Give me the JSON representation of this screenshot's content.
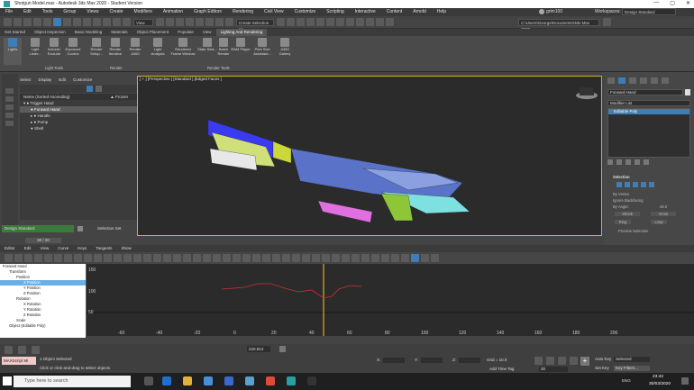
{
  "window": {
    "title": "Shotgun Model.max - Autodesk 3ds Max 2020 - Student Version",
    "controls": [
      "—",
      "▢",
      "✕"
    ]
  },
  "menu": [
    "File",
    "Edit",
    "Tools",
    "Group",
    "Views",
    "Create",
    "Modifiers",
    "Animation",
    "Graph Editors",
    "Rendering",
    "Civil View",
    "Customize",
    "Scripting",
    "Interactive",
    "Content",
    "Arnold",
    "Help"
  ],
  "menu_right": {
    "user": "grim100",
    "workspaces_label": "Workspaces:",
    "workspace": "Design Standard"
  },
  "toolbar": {
    "view_select": "View",
    "selection_set": "Create Selection Se",
    "path": "C:\\Users\\George\\Documents\\3ds Max 2020"
  },
  "ribbon_tabs": [
    "Get Started",
    "Object Inspection",
    "Basic Modeling",
    "Materials",
    "Object Placement",
    "Populate",
    "View",
    "Lighting And Rendering"
  ],
  "ribbon_active": 7,
  "ribbon": {
    "lights": "Lights",
    "buttons": [
      "Light Lister...",
      "Include/ Exclude",
      "Exposure Control",
      "Render Setup...",
      "Render Iterative",
      "Render A360",
      "Light Analysis",
      "Rendered Frame Window",
      "State Sets...",
      "Batch Render",
      "RAM Player",
      "Print Size Assistant...",
      "A360 Gallery"
    ],
    "groups": [
      "Light Tools",
      "Render",
      "Render Tools"
    ]
  },
  "scene": {
    "menu": [
      "Select",
      "Display",
      "Edit",
      "Customize"
    ],
    "col_name": "Name (Sorted Ascending)",
    "col_frozen": "▲ Frozen",
    "items": [
      "Trigger Hand",
      "Forward Hand",
      "Handle",
      "Pump",
      "Shell"
    ],
    "selected": 1,
    "workspace": "Design Standard",
    "selection_set": "Selection Set",
    "frame": "30 / 20"
  },
  "viewport": {
    "label": "[ + ] [Perspective ] [Standard ] [Edged Faces ]"
  },
  "cmd": {
    "object_name": "Forward Hand",
    "modifier_list": "Modifier List",
    "stack_item": "Editable Poly",
    "sections": [
      "Selection",
      "By Vertex",
      "Ignore Backfacing",
      "By Angle:",
      "Shrink",
      "Grow",
      "Ring",
      "Loop",
      "Preview Selection"
    ],
    "angle_value": "45.0"
  },
  "timebar": [
    "Editor",
    "Edit",
    "View",
    "Curve",
    "Keys",
    "Tangents",
    "Show"
  ],
  "curves": {
    "items": [
      "Forward Hand",
      "Transform",
      "Position",
      "X Position",
      "Y Position",
      "Z Position",
      "Rotation",
      "X Rotation",
      "Y Rotation",
      "Z Rotation",
      "Scale",
      "Object (Editable Poly)"
    ],
    "selected": 3,
    "y_ticks": [
      "150",
      "100",
      "50"
    ],
    "x_ticks": [
      "-60",
      "-40",
      "-20",
      "0",
      "20",
      "40",
      "60",
      "80",
      "100",
      "120",
      "140",
      "160",
      "180",
      "200"
    ],
    "bottom_values": [
      "220.913"
    ]
  },
  "status": {
    "selected": "1 Object Selected",
    "hint": "Click or click-and-drag to select objects",
    "script": "MAXScript Mi",
    "grid": "Grid = 10.0",
    "add_time_tag": "Add Time Tag",
    "frame": "30",
    "autokey": "Auto Key",
    "selected_set": "Selected",
    "setkey": "Set Key",
    "key_filters": "Key Filters...",
    "x_label": "X:",
    "y_label": "Y:",
    "z_label": "Z:"
  },
  "taskbar": {
    "search": "Type here to search",
    "time": "23:42",
    "date": "30/03/2020",
    "lang": "ENG"
  },
  "colors": {
    "accent": "#3c7fb8",
    "viewport_frame": "#d6b11e",
    "time_slider": "#d6b11e"
  }
}
